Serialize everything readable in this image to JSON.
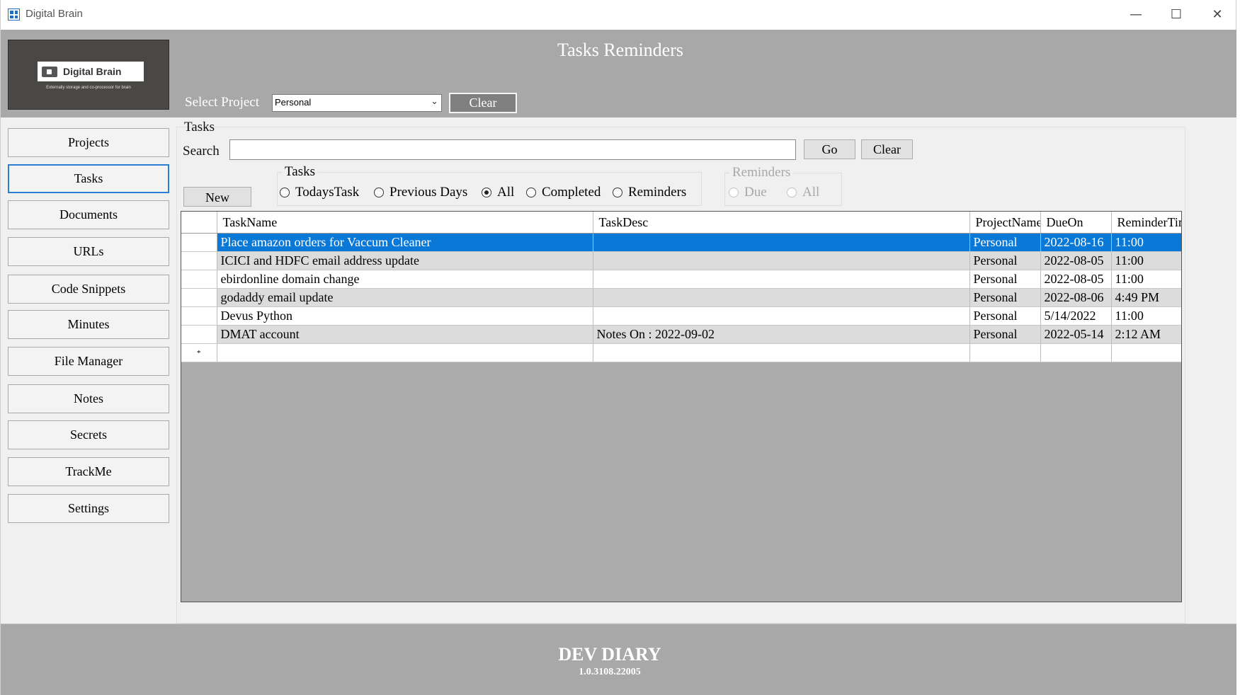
{
  "window": {
    "title": "Digital Brain",
    "minimize": "—",
    "maximize": "☐",
    "close": "✕"
  },
  "header": {
    "logo_text": "Digital Brain",
    "logo_tagline": "Externally storage and co-processor for brain",
    "page_title": "Tasks  Reminders",
    "select_project_label": "Select Project",
    "selected_project": "Personal",
    "clear_label": "Clear"
  },
  "sidebar": {
    "items": [
      {
        "label": "Projects"
      },
      {
        "label": "Tasks",
        "active": true
      },
      {
        "label": "Documents"
      },
      {
        "label": "URLs"
      },
      {
        "label": "Code Snippets"
      },
      {
        "label": "Minutes"
      },
      {
        "label": "File Manager"
      },
      {
        "label": "Notes"
      },
      {
        "label": "Secrets"
      },
      {
        "label": "TrackMe"
      },
      {
        "label": "Settings"
      }
    ]
  },
  "tasks_panel": {
    "group_title": "Tasks",
    "search_label": "Search",
    "search_value": "",
    "go_label": "Go",
    "clear_label": "Clear",
    "new_label": "New",
    "filter_group_title": "Tasks",
    "filters": [
      {
        "label": "TodaysTask",
        "checked": false
      },
      {
        "label": "Previous Days",
        "checked": false
      },
      {
        "label": "All",
        "checked": true
      },
      {
        "label": "Completed",
        "checked": false
      },
      {
        "label": "Reminders",
        "checked": false
      }
    ],
    "reminders_group_title": "Reminders",
    "reminder_filters": [
      {
        "label": "Due",
        "checked": false
      },
      {
        "label": "All",
        "checked": false
      }
    ]
  },
  "grid": {
    "columns": [
      "TaskName",
      "TaskDesc",
      "ProjectName",
      "DueOn",
      "ReminderTime"
    ],
    "rows": [
      {
        "indicator": "▸",
        "TaskName": "Place amazon orders for Vaccum Cleaner",
        "TaskDesc": "",
        "ProjectName": "Personal",
        "DueOn": "2022-08-16",
        "ReminderTime": "11:00"
      },
      {
        "indicator": "",
        "TaskName": "ICICI and HDFC email address update",
        "TaskDesc": "",
        "ProjectName": "Personal",
        "DueOn": "2022-08-05",
        "ReminderTime": "11:00"
      },
      {
        "indicator": "",
        "TaskName": "ebirdonline domain change",
        "TaskDesc": "",
        "ProjectName": "Personal",
        "DueOn": "2022-08-05",
        "ReminderTime": "11:00"
      },
      {
        "indicator": "",
        "TaskName": "godaddy email update",
        "TaskDesc": "",
        "ProjectName": "Personal",
        "DueOn": "2022-08-06",
        "ReminderTime": "4:49 PM"
      },
      {
        "indicator": "",
        "TaskName": "Devus Python",
        "TaskDesc": "",
        "ProjectName": "Personal",
        "DueOn": "5/14/2022",
        "ReminderTime": "11:00"
      },
      {
        "indicator": "",
        "TaskName": "DMAT account",
        "TaskDesc": "Notes On : 2022-09-02",
        "ProjectName": "Personal",
        "DueOn": "2022-05-14",
        "ReminderTime": "2:12 AM"
      }
    ],
    "new_row_indicator": "*"
  },
  "footer": {
    "title": "DEV DIARY",
    "version": "1.0.3108.22005"
  }
}
